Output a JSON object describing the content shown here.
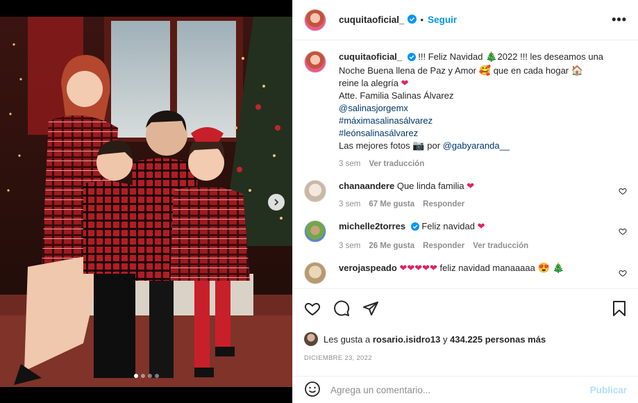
{
  "post": {
    "username": "cuquitaoficial_",
    "follow_label": "Seguir",
    "more_label": "•••",
    "caption": {
      "line1": "!!! Feliz Navidad",
      "line1b": "2022 !!! les deseamos una",
      "line2": "Noche Buena llena de Paz y Amor",
      "line2b": "que en cada hogar",
      "line3": "reine la alegría",
      "line4": "Atte. Familia Salinas Álvarez",
      "mention1": "@salinasjorgemx",
      "tag1": "#máximasalinasálvarez",
      "tag2": "#leónsalinasálvarez",
      "photos_text": "Las mejores fotos",
      "photos_by": "por",
      "mention2": "@gabyaranda__",
      "time": "3 sem",
      "translate": "Ver traducción"
    },
    "likes_prefix": "Les gusta a",
    "likes_user": "rosario.isidro13",
    "likes_and": "y",
    "likes_count": "434.225 personas más",
    "date": "DICIEMBRE 23, 2022",
    "comment_placeholder": "Agrega un comentario...",
    "publish_label": "Publicar"
  },
  "comments": [
    {
      "username": "chanaandere",
      "text": "Que linda familia",
      "time": "3 sem",
      "likes": "67 Me gusta",
      "reply": "Responder"
    },
    {
      "username": "michelle2torres",
      "text": "Feliz navidad",
      "time": "3 sem",
      "likes": "26 Me gusta",
      "reply": "Responder",
      "translate": "Ver traducción"
    },
    {
      "username": "verojaspeado",
      "text": "feliz navidad manaaaaa"
    }
  ],
  "carousel": {
    "slide": 1,
    "total": 4
  },
  "colors": {
    "accent": "#0095f6",
    "heart": "#e0245e",
    "link": "#00376b",
    "muted": "#8e8e8e"
  }
}
